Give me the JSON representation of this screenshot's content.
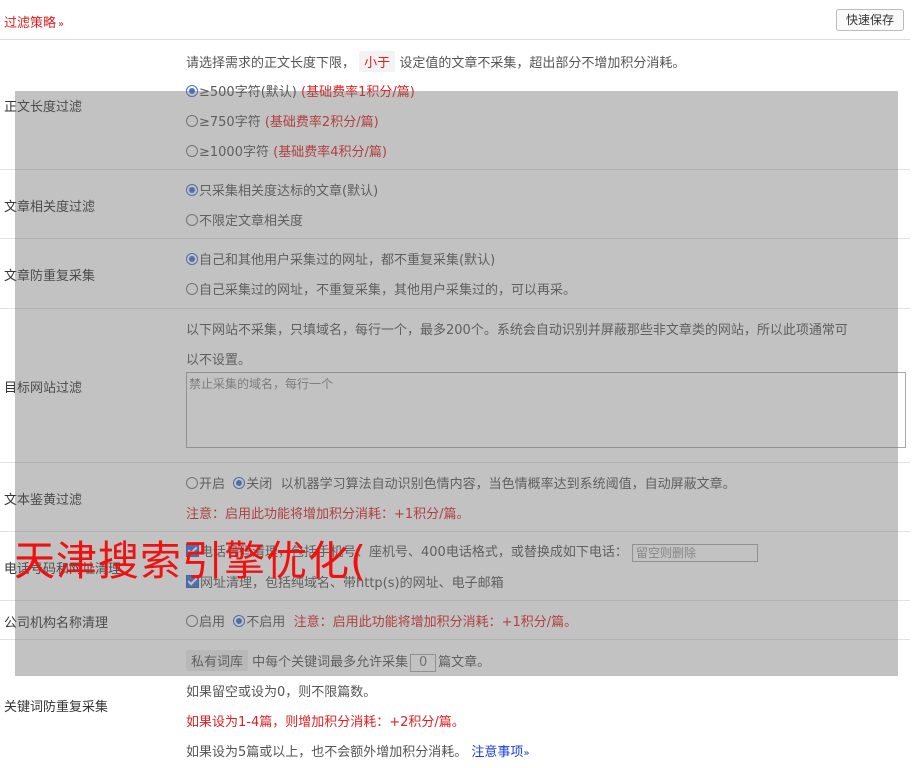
{
  "header": {
    "title": "过滤策略",
    "title_chevron": "»",
    "save_label": "快速保存"
  },
  "length_filter": {
    "label": "正文长度过滤",
    "desc_before": "请选择需求的正文长度下限，",
    "desc_pill": "小于",
    "desc_after": "设定值的文章不采集，超出部分不增加积分消耗。",
    "options": [
      {
        "text": "≥500字符(默认)",
        "note": "(基础费率1积分/篇)",
        "checked": true
      },
      {
        "text": "≥750字符",
        "note": "(基础费率2积分/篇)",
        "checked": false
      },
      {
        "text": "≥1000字符",
        "note": "(基础费率4积分/篇)",
        "checked": false
      }
    ]
  },
  "relevance_filter": {
    "label": "文章相关度过滤",
    "options": [
      {
        "text": "只采集相关度达标的文章(默认)",
        "checked": true
      },
      {
        "text": "不限定文章相关度",
        "checked": false
      }
    ]
  },
  "duplicate_filter": {
    "label": "文章防重复采集",
    "options": [
      {
        "text": "自己和其他用户采集过的网址，都不重复采集(默认)",
        "checked": true
      },
      {
        "text": "自己采集过的网址，不重复采集，其他用户采集过的，可以再采。",
        "checked": false
      }
    ]
  },
  "site_filter": {
    "label": "目标网站过滤",
    "desc_line1": "以下网站不采集，只填域名，每行一个，最多200个。系统会自动识别并屏蔽那些非文章类的网站，所以此项通常可",
    "desc_line2": "以不设置。",
    "placeholder": "禁止采集的域名，每行一个"
  },
  "porn_filter": {
    "label": "文本鉴黄过滤",
    "on_label": "开启",
    "off_label": "关闭",
    "off_checked": true,
    "desc": "以机器学习算法自动识别色情内容，当色情概率达到系统阈值，自动屏蔽文章。",
    "note": "注意：启用此功能将增加积分消耗：+1积分/篇。"
  },
  "contact_cleanup": {
    "label": "电话号码和网址清理",
    "phone_text": "电话号码清理，包括手机号、座机号、400电话格式，或替换成如下电话：",
    "phone_placeholder": "留空则删除",
    "url_text": "网址清理，包括纯域名、带http(s)的网址、电子邮箱"
  },
  "org_cleanup": {
    "label": "公司机构名称清理",
    "on_label": "启用",
    "off_label": "不启用",
    "off_checked": true,
    "note": "注意：启用此功能将增加积分消耗：+1积分/篇。"
  },
  "keyword_dup": {
    "label": "关键词防重复采集",
    "pill": "私有词库",
    "line1_mid": "中每个关键词最多允许采集",
    "count": "0",
    "line1_end": "篇文章。",
    "line2": "如果留空或设为0，则不限篇数。",
    "line3": "如果设为1-4篇，则增加积分消耗：+2积分/篇。",
    "line4": "如果设为5篇或以上，也不会额外增加积分消耗。",
    "notice_link": "注意事项",
    "notice_chevron": "»"
  },
  "watermark": {
    "text": "天津搜索引擎优化("
  },
  "colors": {
    "accent_red": "#e02020",
    "link_blue": "#1a3fd6",
    "radio_blue": "#3a6fd8"
  }
}
